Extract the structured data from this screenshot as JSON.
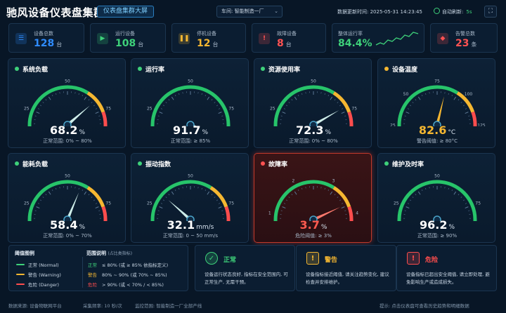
{
  "header": {
    "title": "驰风设备仪表盘集群",
    "view_badge": "仪表盘集群大屏",
    "workshop_label": "车间:",
    "workshop_value": "智能制造一厂",
    "update_label": "数据更新时间:",
    "update_time": "2025-05-31 14:23:45",
    "auto_refresh_label": "自动刷新:",
    "auto_refresh_value": "5s"
  },
  "stats": [
    {
      "label": "设备总数",
      "value": "128",
      "unit": "台",
      "color": "#2f8cff",
      "icon": "server-icon"
    },
    {
      "label": "运行设备",
      "value": "108",
      "unit": "台",
      "color": "#3ed17a",
      "icon": "play-icon"
    },
    {
      "label": "停机设备",
      "value": "12",
      "unit": "台",
      "color": "#f5b731",
      "icon": "pause-icon"
    },
    {
      "label": "故障设备",
      "value": "8",
      "unit": "台",
      "color": "#ff5252",
      "icon": "warning-icon"
    },
    {
      "label": "整体运行率",
      "value": "84.4%",
      "unit": "",
      "color": "#3ed17a",
      "icon": "sparkline-icon"
    },
    {
      "label": "告警总数",
      "value": "23",
      "unit": "条",
      "color": "#ff5252",
      "icon": "bell-icon"
    }
  ],
  "gauges": [
    {
      "title": "系统负载",
      "value": 68.2,
      "display": "68.2",
      "unit": "%",
      "max": 100,
      "ticks": [
        "0",
        "25",
        "50",
        "75",
        "100"
      ],
      "range": "正常范围: 0% ~ 80%",
      "dot": "#3ed17a",
      "value_color": "#ffffff",
      "scheme": "gyr"
    },
    {
      "title": "运行率",
      "value": 91.7,
      "display": "91.7",
      "unit": "%",
      "max": 100,
      "ticks": [
        "0",
        "25",
        "50",
        "75",
        "100"
      ],
      "range": "正常范围: ≥ 85%",
      "dot": "#3ed17a",
      "value_color": "#ffffff",
      "scheme": "green"
    },
    {
      "title": "资源使用率",
      "value": 72.3,
      "display": "72.3",
      "unit": "%",
      "max": 100,
      "ticks": [
        "0",
        "25",
        "50",
        "75",
        "100"
      ],
      "range": "正常范围: 0% ~ 80%",
      "dot": "#3ed17a",
      "value_color": "#ffffff",
      "scheme": "gyr"
    },
    {
      "title": "设备温度",
      "value": 82.6,
      "display": "82.6",
      "unit": "°C",
      "max": 150,
      "ticks": [
        "0",
        "25",
        "50",
        "75",
        "100",
        "125",
        "150"
      ],
      "range": "警告阈值: ≥ 80°C",
      "dot": "#f5b731",
      "value_color": "#f5b731",
      "scheme": "gyr"
    },
    {
      "title": "能耗负载",
      "value": 58.4,
      "display": "58.4",
      "unit": "%",
      "max": 100,
      "ticks": [
        "0",
        "25",
        "50",
        "75",
        "100"
      ],
      "range": "正常范围: 0% ~ 70%",
      "dot": "#3ed17a",
      "value_color": "#ffffff",
      "scheme": "gyr"
    },
    {
      "title": "振动指数",
      "value": 32.1,
      "display": "32.1",
      "unit": "mm/s",
      "max": 100,
      "ticks": [
        "0",
        "25",
        "50",
        "75",
        "100"
      ],
      "range": "正常范围: 0 ~ 50 mm/s",
      "dot": "#3ed17a",
      "value_color": "#ffffff",
      "scheme": "gyr"
    },
    {
      "title": "故障率",
      "value": 3.7,
      "display": "3.7",
      "unit": "%",
      "max": 5,
      "ticks": [
        "0",
        "1",
        "2",
        "3",
        "4",
        "5"
      ],
      "range": "危险阈值: ≥ 3%",
      "dot": "#ff5252",
      "value_color": "#ff5a4f",
      "scheme": "gyr",
      "alert": true
    },
    {
      "title": "维护及时率",
      "value": 96.2,
      "display": "96.2",
      "unit": "%",
      "max": 100,
      "ticks": [
        "0",
        "25",
        "50",
        "75",
        "100"
      ],
      "range": "正常范围: ≥ 90%",
      "dot": "#3ed17a",
      "value_color": "#ffffff",
      "scheme": "green"
    }
  ],
  "legend": {
    "title": "阈值图例",
    "items": [
      {
        "label": "正常 (Normal)",
        "color": "#3ed17a"
      },
      {
        "label": "警告 (Warning)",
        "color": "#f5b731"
      },
      {
        "label": "危险 (Danger)",
        "color": "#ff4d4d"
      }
    ],
    "range_title": "范围说明",
    "range_note": "(占比类指标)",
    "ranges": [
      {
        "key": "正常",
        "text": "≤ 80% (或 ≥ 85% 依指标定义)",
        "color": "#3ed17a"
      },
      {
        "key": "警告",
        "text": "80% ~ 90% (或 70% ~ 85%)",
        "color": "#f5b731"
      },
      {
        "key": "危险",
        "text": "> 90% (或 < 70% / < 85%)",
        "color": "#ff4d4d"
      }
    ]
  },
  "status_cards": [
    {
      "title": "正常",
      "desc": "设备运行状态良好, 指标在安全范围内, 可正常生产, 无需干预。",
      "color": "#3ed17a",
      "icon": "shield-check-icon",
      "glyph": "✓"
    },
    {
      "title": "警告",
      "desc": "设备指标接近阈值, 请关注趋势变化, 建议检查并安排维护。",
      "color": "#f5b731",
      "icon": "warning-triangle-icon",
      "glyph": "!"
    },
    {
      "title": "危险",
      "desc": "设备指标已超出安全阈值, 请立即处理, 避免影响生产或造成损失。",
      "color": "#ff4d4d",
      "icon": "danger-triangle-icon",
      "glyph": "!"
    }
  ],
  "footer": {
    "source": "数据来源: 设备物联网平台",
    "frequency": "采集频率: 10 秒/次",
    "scope": "监控范围: 智能制造一厂全部产线",
    "tip": "提示: 点击仪表盘可查看历史趋势和明细数据"
  }
}
